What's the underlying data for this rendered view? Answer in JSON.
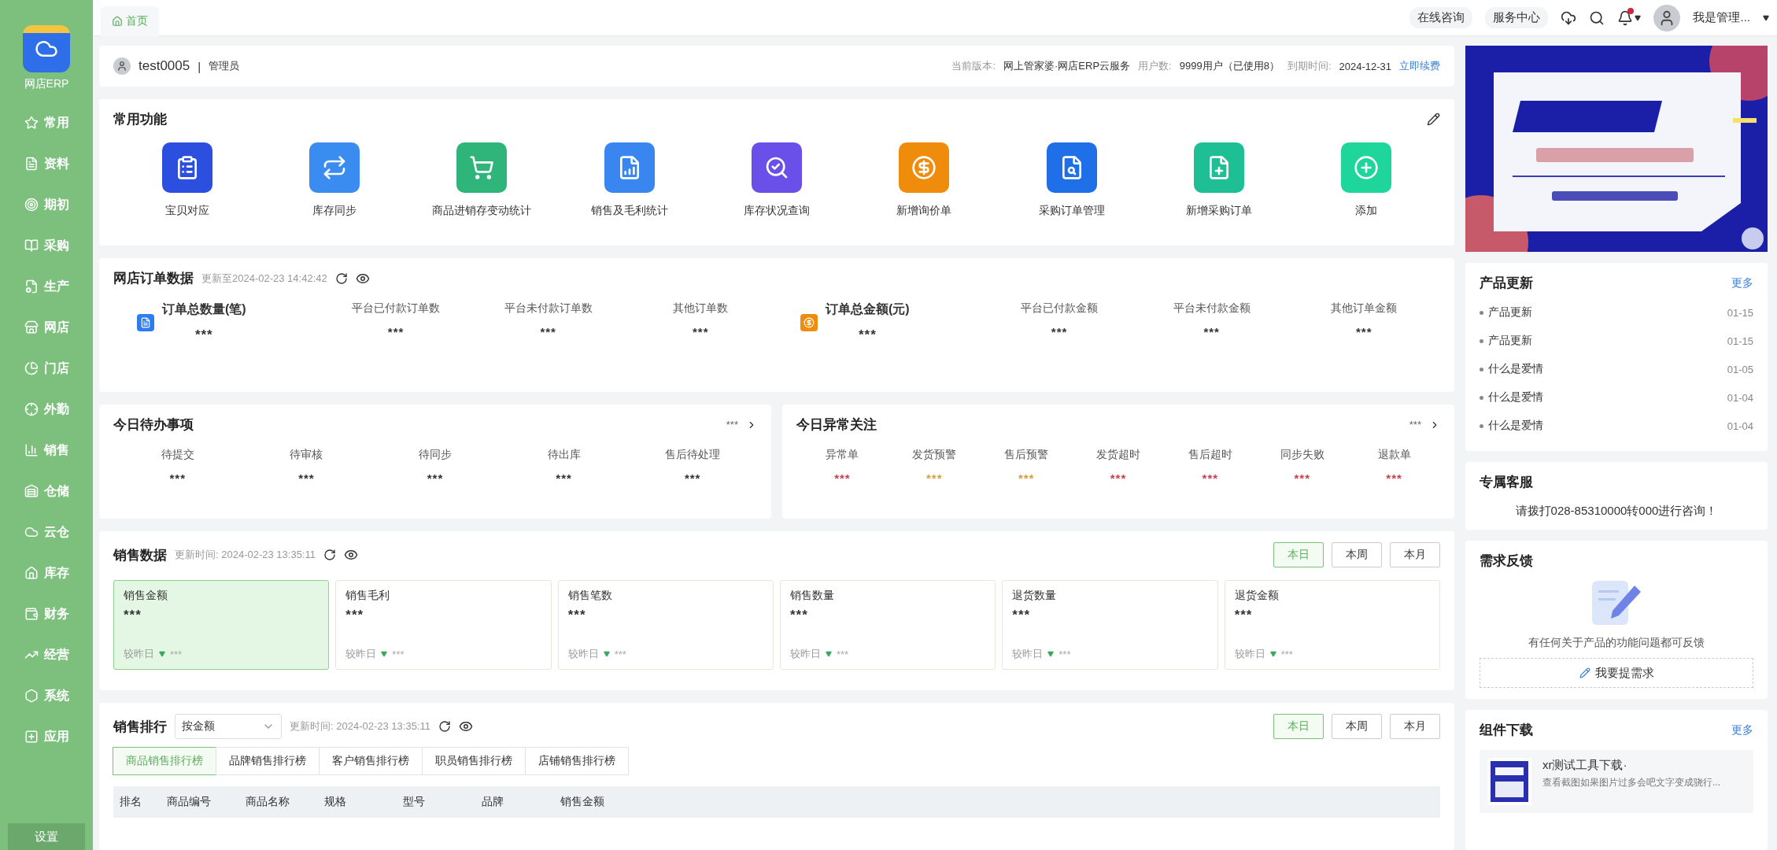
{
  "sidebar": {
    "logo_label": "网店ERP",
    "items": [
      {
        "label": "常用"
      },
      {
        "label": "资料"
      },
      {
        "label": "期初"
      },
      {
        "label": "采购"
      },
      {
        "label": "生产"
      },
      {
        "label": "网店"
      },
      {
        "label": "门店"
      },
      {
        "label": "外勤"
      },
      {
        "label": "销售"
      },
      {
        "label": "仓储"
      },
      {
        "label": "云仓"
      },
      {
        "label": "库存"
      },
      {
        "label": "财务"
      },
      {
        "label": "经营"
      },
      {
        "label": "系统"
      },
      {
        "label": "应用"
      }
    ],
    "settings": "设置"
  },
  "topbar": {
    "tabs": [
      {
        "label": "首页",
        "selected": true
      }
    ],
    "links": [
      "在线咨询",
      "服务中心"
    ],
    "has_notification": true,
    "user": "我是管理..."
  },
  "header": {
    "username": "test0005",
    "separator": "|",
    "role": "管理员",
    "fields": [
      {
        "label": "当前版本:",
        "value": "网上管家婆·网店ERP云服务"
      },
      {
        "label": "用户数:",
        "value": "9999用户（已使用8）"
      },
      {
        "label": "到期时间:",
        "value": "2024-12-31"
      }
    ],
    "renew_link": "立即续费"
  },
  "functions": {
    "title": "常用功能",
    "items": [
      {
        "label": "宝贝对应",
        "color": "#2d4fe0"
      },
      {
        "label": "库存同步",
        "color": "#3b8cf0"
      },
      {
        "label": "商品进销存变动统计",
        "color": "#2fb57a"
      },
      {
        "label": "销售及毛利统计",
        "color": "#3a86f0"
      },
      {
        "label": "库存状况查询",
        "color": "#6a4fe8"
      },
      {
        "label": "新增询价单",
        "color": "#f08c0c"
      },
      {
        "label": "采购订单管理",
        "color": "#1f6fe8"
      },
      {
        "label": "新增采购订单",
        "color": "#1fbf96"
      },
      {
        "label": "添加",
        "color": "#1ed69a"
      }
    ]
  },
  "order_data": {
    "title": "网店订单数据",
    "updated": "更新至2024-02-23 14:42:42",
    "groups": [
      {
        "kind": "count",
        "title": "订单总数量(笔)",
        "value": "***",
        "stats": [
          {
            "label": "平台已付款订单数",
            "value": "***"
          },
          {
            "label": "平台未付款订单数",
            "value": "***"
          },
          {
            "label": "其他订单数",
            "value": "***"
          }
        ]
      },
      {
        "kind": "amount",
        "title": "订单总金额(元)",
        "value": "***",
        "stats": [
          {
            "label": "平台已付款金额",
            "value": "***"
          },
          {
            "label": "平台未付款金额",
            "value": "***"
          },
          {
            "label": "其他订单金额",
            "value": "***"
          }
        ]
      }
    ]
  },
  "todo": {
    "title": "今日待办事项",
    "more": "***",
    "items": [
      {
        "label": "待提交",
        "value": "***"
      },
      {
        "label": "待审核",
        "value": "***"
      },
      {
        "label": "待同步",
        "value": "***"
      },
      {
        "label": "待出库",
        "value": "***"
      },
      {
        "label": "售后待处理",
        "value": "***"
      }
    ]
  },
  "alerts": {
    "title": "今日异常关注",
    "more": "***",
    "items": [
      {
        "label": "异常单",
        "value": "***",
        "color": "#c9434f"
      },
      {
        "label": "发货预警",
        "value": "***",
        "color": "#d9a040"
      },
      {
        "label": "售后预警",
        "value": "***",
        "color": "#d9a040"
      },
      {
        "label": "发货超时",
        "value": "***",
        "color": "#c9434f"
      },
      {
        "label": "售后超时",
        "value": "***",
        "color": "#c9434f"
      },
      {
        "label": "同步失败",
        "value": "***",
        "color": "#c9434f"
      },
      {
        "label": "退款单",
        "value": "***",
        "color": "#c9434f"
      }
    ]
  },
  "sales": {
    "title": "销售数据",
    "updated": "更新时间: 2024-02-23 13:35:11",
    "periods": [
      {
        "label": "本日",
        "selected": true
      },
      {
        "label": "本周",
        "selected": false
      },
      {
        "label": "本月",
        "selected": false
      }
    ],
    "cards": [
      {
        "label": "销售金额",
        "value": "***",
        "compare": "较昨日",
        "change": "***",
        "selected": true
      },
      {
        "label": "销售毛利",
        "value": "***",
        "compare": "较昨日",
        "change": "***",
        "selected": false
      },
      {
        "label": "销售笔数",
        "value": "***",
        "compare": "较昨日",
        "change": "***",
        "selected": false
      },
      {
        "label": "销售数量",
        "value": "***",
        "compare": "较昨日",
        "change": "***",
        "selected": false
      },
      {
        "label": "退货数量",
        "value": "***",
        "compare": "较昨日",
        "change": "***",
        "selected": false
      },
      {
        "label": "退货金额",
        "value": "***",
        "compare": "较昨日",
        "change": "***",
        "selected": false
      }
    ]
  },
  "ranking": {
    "title": "销售排行",
    "sort": "按金额",
    "updated": "更新时间: 2024-02-23 13:35:11",
    "periods": [
      {
        "label": "本日",
        "selected": true
      },
      {
        "label": "本周",
        "selected": false
      },
      {
        "label": "本月",
        "selected": false
      }
    ],
    "tabs": [
      {
        "label": "商品销售排行榜",
        "selected": true
      },
      {
        "label": "品牌销售排行榜",
        "selected": false
      },
      {
        "label": "客户销售排行榜",
        "selected": false
      },
      {
        "label": "职员销售排行榜",
        "selected": false
      },
      {
        "label": "店铺销售排行榜",
        "selected": false
      }
    ],
    "columns": [
      "排名",
      "商品编号",
      "商品名称",
      "规格",
      "型号",
      "品牌",
      "销售金额"
    ]
  },
  "updates": {
    "title": "产品更新",
    "more": "更多",
    "items": [
      {
        "title": "产品更新",
        "date": "01-15"
      },
      {
        "title": "产品更新",
        "date": "01-15"
      },
      {
        "title": "什么是爱情",
        "date": "01-05"
      },
      {
        "title": "什么是爱情",
        "date": "01-04"
      },
      {
        "title": "什么是爱情",
        "date": "01-04"
      }
    ]
  },
  "service": {
    "title": "专属客服",
    "text": "请拨打028-85310000转000进行咨询！"
  },
  "feedback": {
    "title": "需求反馈",
    "text": "有任何关于产品的功能问题都可反馈",
    "button": "我要提需求"
  },
  "downloads": {
    "title": "组件下载",
    "more": "更多",
    "items": [
      {
        "title": "xr测试工具下载·",
        "description": "查看截图如果图片过多会吧文字变成骁行..."
      }
    ]
  }
}
